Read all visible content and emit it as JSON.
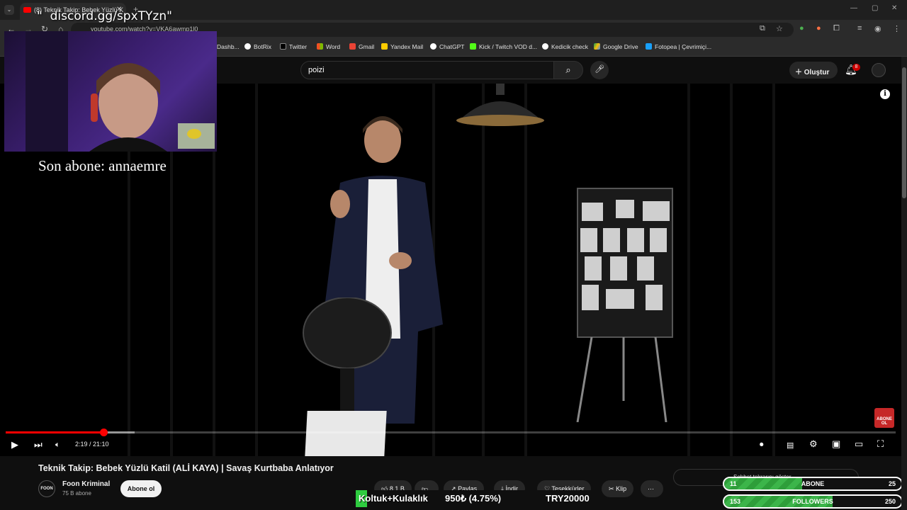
{
  "browser": {
    "tab_title": "(8) Teknik Takip: Bebek Yüzlü K",
    "url": "youtube.com/watch?v=VKA6awmp1l0",
    "bookmarks": [
      "Dashb...",
      "BotRix",
      "Twitter",
      "Word",
      "Gmail",
      "Yandex Mail",
      "ChatGPT",
      "Kick / Twitch VOD d...",
      "Kedicik check",
      "Google Drive",
      "Fotopea | Çevrimiçi..."
    ]
  },
  "youtube": {
    "search_value": "poizi",
    "create_label": "Oluştur",
    "notification_count": "8"
  },
  "player": {
    "time": "2:19 / 21:10",
    "progress_fraction": 0.11,
    "buffer_fraction": 0.145,
    "subscribe_logo_text": "ABONE OL"
  },
  "video": {
    "title": "Teknik Takip: Bebek Yüzlü Katil (ALİ KAYA) | Savaş Kurtbaba Anlatıyor",
    "channel_name": "Foon Kriminal",
    "channel_avatar_text": "FOON",
    "subscribers": "75 B abone",
    "subscribe_label": "Abone ol",
    "likes": "8,1 B",
    "share_label": "Paylaş",
    "download_label": "İndir",
    "thanks_label": "Teşekkürler",
    "clip_label": "Klip",
    "chat_label": "Sohbet tekrarını göster"
  },
  "overlay": {
    "discord": "\"  discord.gg/spxTYzn\"",
    "last_sub": "Son abone: annaemre",
    "donation_item": "Koltuk+Kulaklık",
    "donation_amount": "950₺ (4.75%)",
    "donation_goal": "TRY20000",
    "goals": [
      {
        "current": "11",
        "label": "ABONE",
        "target": "25",
        "fraction": 0.44
      },
      {
        "current": "153",
        "label": "FOLLOWERS",
        "target": "250",
        "fraction": 0.61
      }
    ]
  },
  "colors": {
    "accent": "#ff0000",
    "goal_fill": "#3cb54a"
  }
}
